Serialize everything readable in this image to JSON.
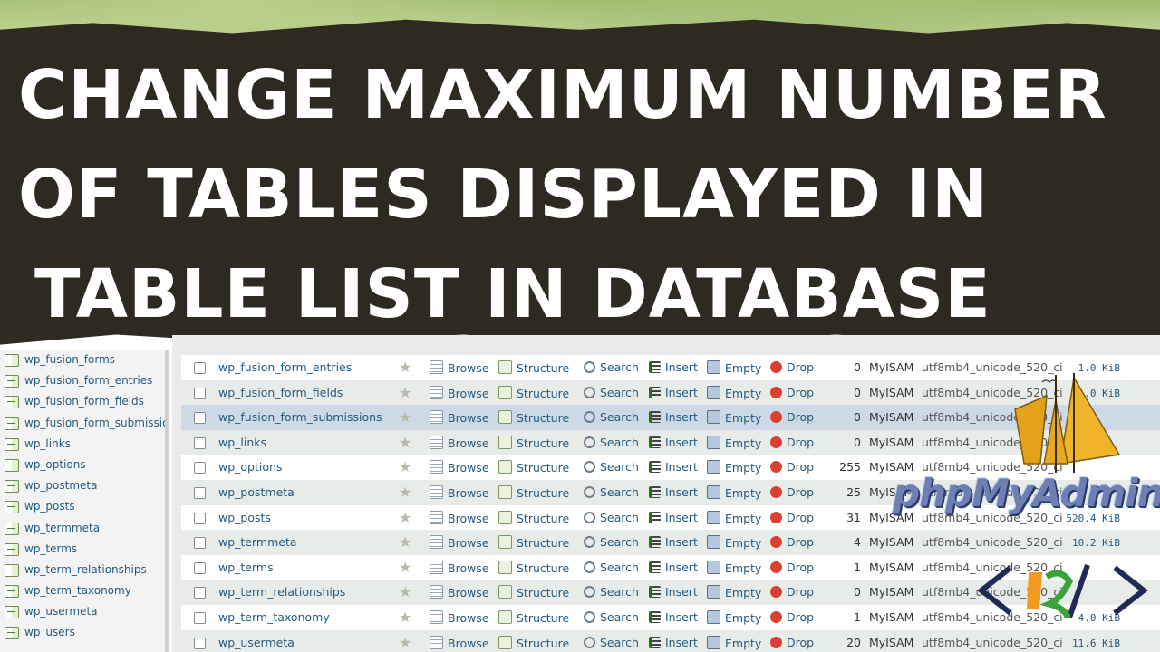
{
  "banner": {
    "line1": "CHANGE MAXIMUM NUMBER",
    "line2": "OF TABLES DISPLAYED IN",
    "line3": "TABLE LIST IN DATABASE"
  },
  "sidebar": {
    "items": [
      {
        "label": "wp_fusion_forms"
      },
      {
        "label": "wp_fusion_form_entries"
      },
      {
        "label": "wp_fusion_form_fields"
      },
      {
        "label": "wp_fusion_form_submissions"
      },
      {
        "label": "wp_links"
      },
      {
        "label": "wp_options"
      },
      {
        "label": "wp_postmeta"
      },
      {
        "label": "wp_posts"
      },
      {
        "label": "wp_termmeta"
      },
      {
        "label": "wp_terms"
      },
      {
        "label": "wp_term_relationships"
      },
      {
        "label": "wp_term_taxonomy"
      },
      {
        "label": "wp_usermeta"
      },
      {
        "label": "wp_users"
      }
    ]
  },
  "actions": {
    "browse": "Browse",
    "structure": "Structure",
    "search": "Search",
    "insert": "Insert",
    "empty": "Empty",
    "drop": "Drop"
  },
  "table": {
    "rows": [
      {
        "name": "wp_fusion_form_entries",
        "rows": "0",
        "engine": "MyISAM",
        "collation": "utf8mb4_unicode_520_ci",
        "size": "1.0 KiB"
      },
      {
        "name": "wp_fusion_form_fields",
        "rows": "0",
        "engine": "MyISAM",
        "collation": "utf8mb4_unicode_520_ci",
        "size": "1.0 KiB"
      },
      {
        "name": "wp_fusion_form_submissions",
        "rows": "0",
        "engine": "MyISAM",
        "collation": "utf8mb4_unicode_520_ci",
        "size": ""
      },
      {
        "name": "wp_links",
        "rows": "0",
        "engine": "MyISAM",
        "collation": "utf8mb4_unicode_520_ci",
        "size": ""
      },
      {
        "name": "wp_options",
        "rows": "255",
        "engine": "MyISAM",
        "collation": "utf8mb4_unicode_520_ci",
        "size": ""
      },
      {
        "name": "wp_postmeta",
        "rows": "25",
        "engine": "MyISAM",
        "collation": "utf8mb4_unicode_520_ci",
        "size": ""
      },
      {
        "name": "wp_posts",
        "rows": "31",
        "engine": "MyISAM",
        "collation": "utf8mb4_unicode_520_ci",
        "size": "520.4 KiB"
      },
      {
        "name": "wp_termmeta",
        "rows": "4",
        "engine": "MyISAM",
        "collation": "utf8mb4_unicode_520_ci",
        "size": "10.2 KiB"
      },
      {
        "name": "wp_terms",
        "rows": "1",
        "engine": "MyISAM",
        "collation": "utf8mb4_unicode_520_ci",
        "size": ""
      },
      {
        "name": "wp_term_relationships",
        "rows": "0",
        "engine": "MyISAM",
        "collation": "utf8mb4_unicode_520_ci",
        "size": ""
      },
      {
        "name": "wp_term_taxonomy",
        "rows": "1",
        "engine": "MyISAM",
        "collation": "utf8mb4_unicode_520_ci",
        "size": "4.0 KiB"
      },
      {
        "name": "wp_usermeta",
        "rows": "20",
        "engine": "MyISAM",
        "collation": "utf8mb4_unicode_520_ci",
        "size": "11.6 KiB"
      }
    ]
  },
  "logo": {
    "text": "phpMyAdmin"
  },
  "colors": {
    "banner_bg": "#2e2a22",
    "link_blue": "#235a81",
    "highlight_row": "#cdd9e6",
    "drop_red": "#d8412f"
  }
}
